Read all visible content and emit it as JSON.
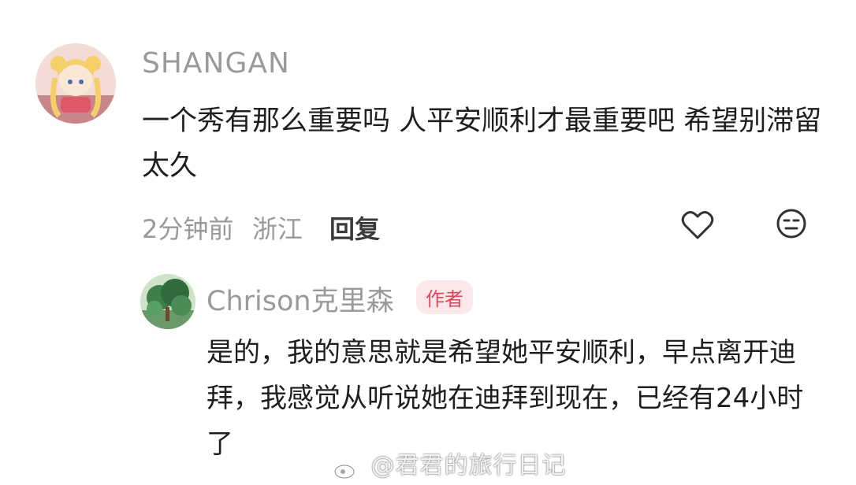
{
  "comment": {
    "username": "SHANGAN",
    "text": "一个秀有那么重要吗 人平安顺利才最重要吧 希望别滞留太久",
    "time": "2分钟前",
    "location": "浙江",
    "reply_label": "回复",
    "like_icon": "heart-icon",
    "dislike_icon": "neutral-face-icon"
  },
  "reply": {
    "username": "Chrison克里森",
    "badge": "作者",
    "text": "是的，我的意思就是希望她平安顺利，早点离开迪拜，我感觉从听说她在迪拜到现在，已经有24小时了"
  },
  "watermark": {
    "text": "@君君的旅行日记"
  },
  "colors": {
    "username_gray": "#9a9a9a",
    "badge_bg": "#fbe8ea",
    "badge_text": "#e0445a"
  }
}
